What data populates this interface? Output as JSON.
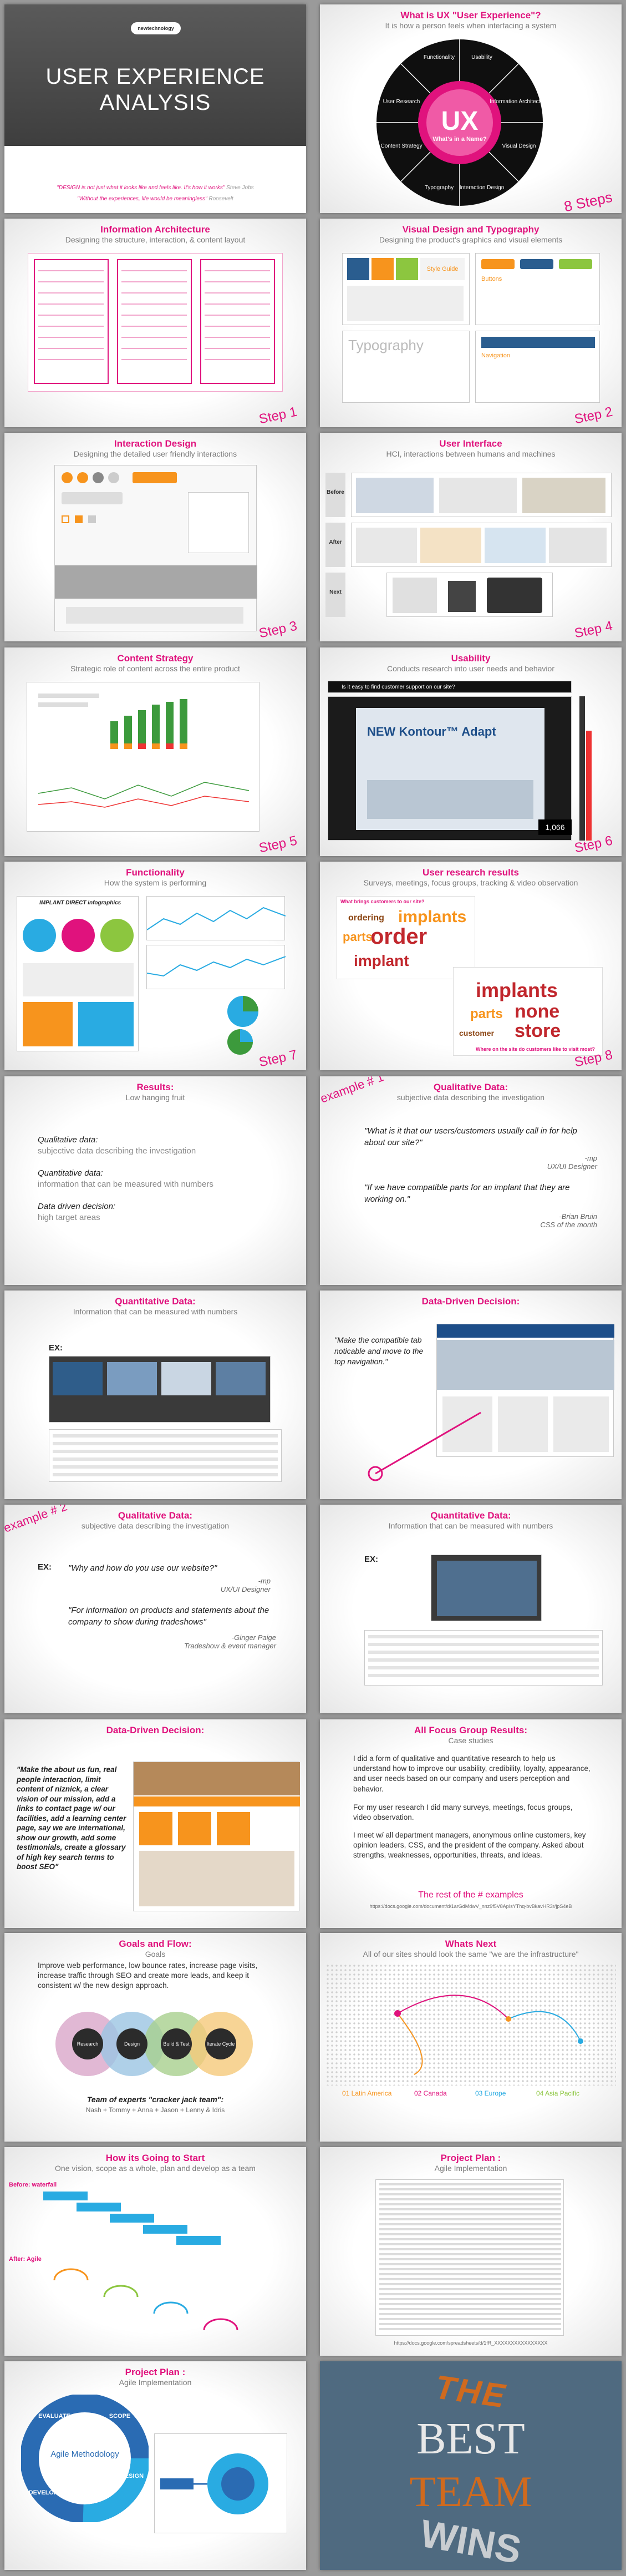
{
  "cover": {
    "logo_text": "newtechnology",
    "title_line1": "USER EXPERIENCE",
    "title_line2": "ANALYSIS",
    "quote1": "\"DESIGN is not just what it looks like and feels like. It's how it works\"",
    "quote1_author": "Steve Jobs",
    "quote2": "\"Without the experiences, life would be meaningless\"",
    "quote2_author": "Roosevelt"
  },
  "ux_wheel": {
    "title": "What is UX \"User Experience\"?",
    "subtitle": "It is how a person feels when interfacing a system",
    "center_big": "UX",
    "center_small": "What's in a Name?",
    "segments": [
      "Functionality",
      "Usability",
      "Information Architecture",
      "Visual Design",
      "Interaction Design",
      "Typography",
      "Content Strategy",
      "User Research"
    ],
    "steps_label": "8 Steps"
  },
  "slides": {
    "ia": {
      "title": "Information Architecture",
      "subtitle": "Designing the structure, interaction, & content layout",
      "step": "Step 1"
    },
    "visual": {
      "title": "Visual Design and Typography",
      "subtitle": "Designing the product's graphics and visual elements",
      "step": "Step 2",
      "tags": [
        "Style Guide",
        "Buttons",
        "Typography",
        "Navigation"
      ]
    },
    "interaction": {
      "title": "Interaction Design",
      "subtitle": "Designing the detailed user friendly interactions",
      "step": "Step 3"
    },
    "ui": {
      "title": "User Interface",
      "subtitle": "HCI, interactions between humans and machines",
      "step": "Step 4",
      "rows": [
        "Before",
        "After",
        "Next"
      ]
    },
    "content": {
      "title": "Content Strategy",
      "subtitle": "Strategic role of content across the entire product",
      "step": "Step 5"
    },
    "usability": {
      "title": "Usability",
      "subtitle": "Conducts research into user needs and behavior",
      "step": "Step 6",
      "question": "Is it easy to find customer support on our site?",
      "promo": "NEW Kontour™ Adapt",
      "counter": "1,066"
    },
    "functionality": {
      "title": "Functionality",
      "subtitle": "How the system is performing",
      "step": "Step 7",
      "infographic": "IMPLANT DIRECT infographics"
    },
    "research": {
      "title": "User research results",
      "subtitle": "Surveys, meetings, focus groups, tracking & video observation",
      "step": "Step 8",
      "q1": "What brings customers to our site?",
      "q2": "Where on the site do customers like to visit most?",
      "words1": [
        "order",
        "implants",
        "parts",
        "implant",
        "ordering"
      ],
      "words2": [
        "implants",
        "none",
        "store",
        "parts",
        "customer"
      ]
    },
    "results": {
      "title": "Results:",
      "subtitle": "Low hanging fruit",
      "qual_label": "Qualitative data:",
      "qual_desc": "subjective data describing the investigation",
      "quant_label": "Quantitative data:",
      "quant_desc": "information that can be measured with numbers",
      "driven_label": "Data driven decision:",
      "driven_desc": "high target areas"
    },
    "qual1": {
      "title": "Qualitative Data:",
      "subtitle": "subjective data describing the investigation",
      "example": "example # 1",
      "q1": "\"What is it that our users/customers usually call in for help about our site?\"",
      "a1_name": "-mp",
      "a1_role": "UX/UI Designer",
      "q2": "\"If we have compatible parts for an implant that they are working on.\"",
      "a2_name": "-Brian Bruin",
      "a2_role": "CSS of the month"
    },
    "quant1": {
      "title": "Quantitative Data:",
      "subtitle": "Information that can be measured with numbers",
      "ex": "EX:"
    },
    "ddd1": {
      "title": "Data-Driven Decision:",
      "quote": "\"Make the compatible tab noticable and move to the top navigation.\""
    },
    "qual2": {
      "title": "Qualitative Data:",
      "subtitle": "subjective data describing the investigation",
      "example": "example # 2",
      "ex": "EX:",
      "q1": "\"Why and how do you use our website?\"",
      "a1_name": "-mp",
      "a1_role": "UX/UI Designer",
      "q2": "\"For information on products and statements about the company to show during tradeshows\"",
      "a2_name": "-Ginger Paige",
      "a2_role": "Tradeshow & event manager"
    },
    "quant2": {
      "title": "Quantitative Data:",
      "subtitle": "Information that can be measured with numbers",
      "ex": "EX:"
    },
    "ddd2": {
      "title": "Data-Driven Decision:",
      "quote": "\"Make the about us fun, real people interaction, limit content of niznick, a clear vision of our mission, add a links to contact page w/ our facilities, add a learning center page, say we are international, show our growth, add some testimonials, create a glossary of high key search terms to boost SEO\""
    },
    "focus": {
      "title": "All Focus Group Results:",
      "subtitle": "Case studies",
      "p1": "I did a form of qualitative and quantitative research to help us understand how to improve our usability, credibility, loyalty, appearance, and user needs based on our company and users perception and behavior.",
      "p2": "For my user research I did many surveys, meetings, focus groups, video observation.",
      "p3": "I meet w/ all department managers, anonymous online customers, key opinion leaders, CSS, and the president of the company. Asked about strengths, weaknesses, opportunities, threats, and ideas.",
      "rest": "The rest of the # examples",
      "link": "https://docs.google.com/document/d/1arGdMdwV_nnz9f5V8ApIsYThq-bvBkavHR3r/jpS4eB"
    },
    "goals": {
      "title": "Goals and Flow:",
      "subtitle": "Goals",
      "text": "Improve web performance, low bounce rates, increase page visits, increase traffic through SEO and create more leads, and keep it consistent w/ the new design approach.",
      "circles": [
        "Research",
        "Design",
        "Build & Test",
        "Iterate Cycle"
      ],
      "team_label": "Team of experts \"cracker jack team\":",
      "team": "Nash + Tommy + Anna + Jason + Lenny & Idris"
    },
    "next": {
      "title": "Whats Next",
      "subtitle": "All of our sites should look the same \"we are the infrastructure\"",
      "regions": [
        "01 Latin America",
        "02 Canada",
        "03 Europe",
        "04 Asia Pacific"
      ]
    },
    "start": {
      "title": "How its Going to Start",
      "subtitle": "One vision, scope as a whole, plan and develop as a team",
      "before": "Before: waterfall",
      "after": "After: Agile"
    },
    "plan1": {
      "title": "Project Plan :",
      "subtitle": "Agile Implementation",
      "link": "https://docs.google.com/spreadsheets/d/1fR_XXXXXXXXXXXXXXXX"
    },
    "plan2": {
      "title": "Project Plan :",
      "subtitle": "Agile Implementation",
      "center": "Agile Methodology",
      "ring": [
        "EVALUATE",
        "SCOPE",
        "DESIGN",
        "DEVELOP"
      ]
    },
    "best": {
      "w1": "THE",
      "w2": "BEST",
      "w3": "TEAM",
      "w4": "WINS"
    }
  },
  "colors": {
    "accent": "#e0127d",
    "muted": "#7a7a7a"
  }
}
